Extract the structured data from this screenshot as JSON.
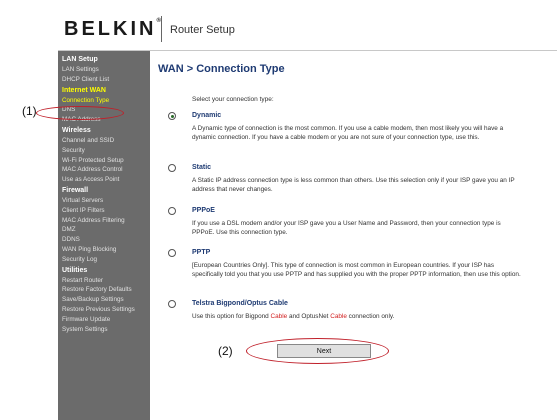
{
  "header": {
    "brand": "BELKIN",
    "brand_mark": "®",
    "title": "Router Setup"
  },
  "sidebar": {
    "sections": [
      {
        "title": "LAN Setup",
        "items": [
          "LAN Settings",
          "DHCP Client List"
        ]
      },
      {
        "title": "Internet WAN",
        "active": true,
        "items": [
          "Connection Type",
          "DNS",
          "MAC Address"
        ]
      },
      {
        "title": "Wireless",
        "items": [
          "Channel and SSID",
          "Security",
          "Wi-Fi Protected Setup",
          "MAC Address Control",
          "Use as Access Point"
        ]
      },
      {
        "title": "Firewall",
        "items": [
          "Virtual Servers",
          "Client IP Filters",
          "MAC Address Filtering",
          "DMZ",
          "DDNS",
          "WAN Ping Blocking",
          "Security Log"
        ]
      },
      {
        "title": "Utilities",
        "items": [
          "Restart Router",
          "Restore Factory Defaults",
          "Save/Backup Settings",
          "Restore Previous Settings",
          "Firmware Update",
          "System Settings"
        ]
      }
    ],
    "current_item": "Connection Type"
  },
  "main": {
    "title": "WAN > Connection Type",
    "prompt": "Select your connection type:",
    "options": [
      {
        "label": "Dynamic",
        "checked": true,
        "desc": "A Dynamic type of connection is the most common. If you use a cable modem, then most likely you will have a dynamic connection. If you have a cable modem or you are not sure of your connection type, use this."
      },
      {
        "label": "Static",
        "checked": false,
        "desc": "A Static IP address connection type is less common than others. Use this selection only if your ISP gave you an IP address that never changes."
      },
      {
        "label": "PPPoE",
        "checked": false,
        "desc": "If you use a DSL modem and/or your ISP gave you a User Name and Password, then your connection type is PPPoE. Use this connection type."
      },
      {
        "label": "PPTP",
        "checked": false,
        "desc": "[European Countries Only]. This type of connection is most common in European countries. If your ISP has specifically told you that you use PPTP and has supplied you with the proper PPTP information, then use this option."
      },
      {
        "label": "Telstra Bigpond/Optus Cable",
        "checked": false,
        "desc_parts": [
          "Use this option for Bigpond ",
          "Cable",
          " and OptusNet ",
          "Cable",
          " connection only."
        ]
      }
    ],
    "next_label": "Next"
  },
  "callouts": {
    "one": "(1)",
    "two": "(2)"
  },
  "colors": {
    "sidebar_bg": "#6b6b6b",
    "title_blue": "#1f3b73",
    "highlight_yellow": "#ffff00",
    "callout_red": "#c0202a"
  }
}
